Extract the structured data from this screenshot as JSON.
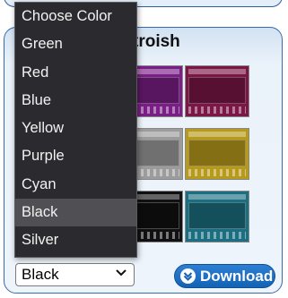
{
  "card": {
    "title": "troish"
  },
  "dropdown": {
    "options": [
      "Choose Color",
      "Green",
      "Red",
      "Blue",
      "Yellow",
      "Purple",
      "Cyan",
      "Black",
      "Silver"
    ],
    "selected_index": 7
  },
  "select": {
    "value": "Black"
  },
  "download": {
    "label": "Download"
  },
  "thumbs": [
    {
      "color": "#7a1f86"
    },
    {
      "color": "#7b1746"
    },
    {
      "color": "#9c9c9c"
    },
    {
      "color": "#b79a1c"
    },
    {
      "color": "#111111"
    },
    {
      "color": "#1b6f80"
    }
  ],
  "colors": {
    "accent": "#1463b5",
    "dropdown_bg": "#2b2b2f",
    "selected_bg": "#505054"
  }
}
